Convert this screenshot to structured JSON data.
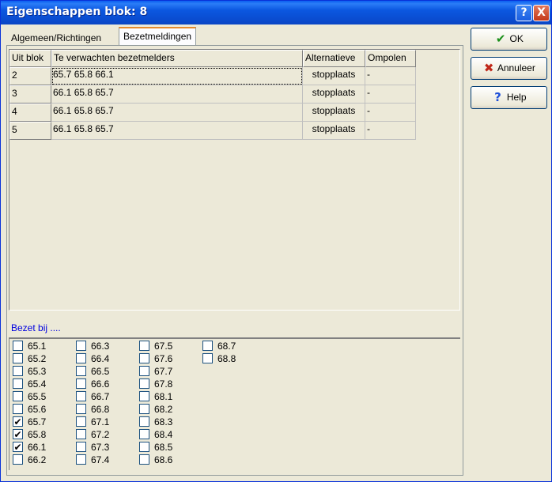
{
  "window": {
    "title": "Eigenschappen blok: 8",
    "help_glyph": "?",
    "close_glyph": "X"
  },
  "tabs": [
    {
      "label": "Algemeen/Richtingen",
      "active": false
    },
    {
      "label": "Bezetmeldingen",
      "active": true
    }
  ],
  "grid": {
    "headers": [
      "Uit blok",
      "Te verwachten bezetmelders",
      "Alternatieve",
      "Ompolen"
    ],
    "rows": [
      {
        "uit_blok": "2",
        "melders": "65.7  65.8  66.1",
        "alternatieve": "stopplaats",
        "ompolen": "-"
      },
      {
        "uit_blok": "3",
        "melders": "66.1  65.8  65.7",
        "alternatieve": "stopplaats",
        "ompolen": "-"
      },
      {
        "uit_blok": "4",
        "melders": "66.1  65.8  65.7",
        "alternatieve": "stopplaats",
        "ompolen": "-"
      },
      {
        "uit_blok": "5",
        "melders": "66.1  65.8  65.7",
        "alternatieve": "stopplaats",
        "ompolen": "-"
      }
    ]
  },
  "bezet_bij": {
    "label": "Bezet bij ....",
    "columns": [
      [
        {
          "label": "65.1",
          "checked": false
        },
        {
          "label": "65.2",
          "checked": false
        },
        {
          "label": "65.3",
          "checked": false
        },
        {
          "label": "65.4",
          "checked": false
        },
        {
          "label": "65.5",
          "checked": false
        },
        {
          "label": "65.6",
          "checked": false
        },
        {
          "label": "65.7",
          "checked": true
        },
        {
          "label": "65.8",
          "checked": true
        },
        {
          "label": "66.1",
          "checked": true
        },
        {
          "label": "66.2",
          "checked": false
        }
      ],
      [
        {
          "label": "66.3",
          "checked": false
        },
        {
          "label": "66.4",
          "checked": false
        },
        {
          "label": "66.5",
          "checked": false
        },
        {
          "label": "66.6",
          "checked": false
        },
        {
          "label": "66.7",
          "checked": false
        },
        {
          "label": "66.8",
          "checked": false
        },
        {
          "label": "67.1",
          "checked": false
        },
        {
          "label": "67.2",
          "checked": false
        },
        {
          "label": "67.3",
          "checked": false
        },
        {
          "label": "67.4",
          "checked": false
        }
      ],
      [
        {
          "label": "67.5",
          "checked": false
        },
        {
          "label": "67.6",
          "checked": false
        },
        {
          "label": "67.7",
          "checked": false
        },
        {
          "label": "67.8",
          "checked": false
        },
        {
          "label": "68.1",
          "checked": false
        },
        {
          "label": "68.2",
          "checked": false
        },
        {
          "label": "68.3",
          "checked": false
        },
        {
          "label": "68.4",
          "checked": false
        },
        {
          "label": "68.5",
          "checked": false
        },
        {
          "label": "68.6",
          "checked": false
        }
      ],
      [
        {
          "label": "68.7",
          "checked": false
        },
        {
          "label": "68.8",
          "checked": false
        }
      ]
    ]
  },
  "buttons": {
    "ok": {
      "label": "OK",
      "icon": "check-icon",
      "glyph": "✔",
      "color": "#1a8f1a"
    },
    "cancel": {
      "label": "Annuleer",
      "icon": "cross-icon",
      "glyph": "✖",
      "color": "#c0281a"
    },
    "help": {
      "label": "Help",
      "icon": "question-icon",
      "glyph": "?",
      "color": "#1e4fd8"
    }
  },
  "colors": {
    "title_bar": "#0a5ef0",
    "tab_highlight": "#e68b2c",
    "bezet_label": "#0000e0"
  }
}
